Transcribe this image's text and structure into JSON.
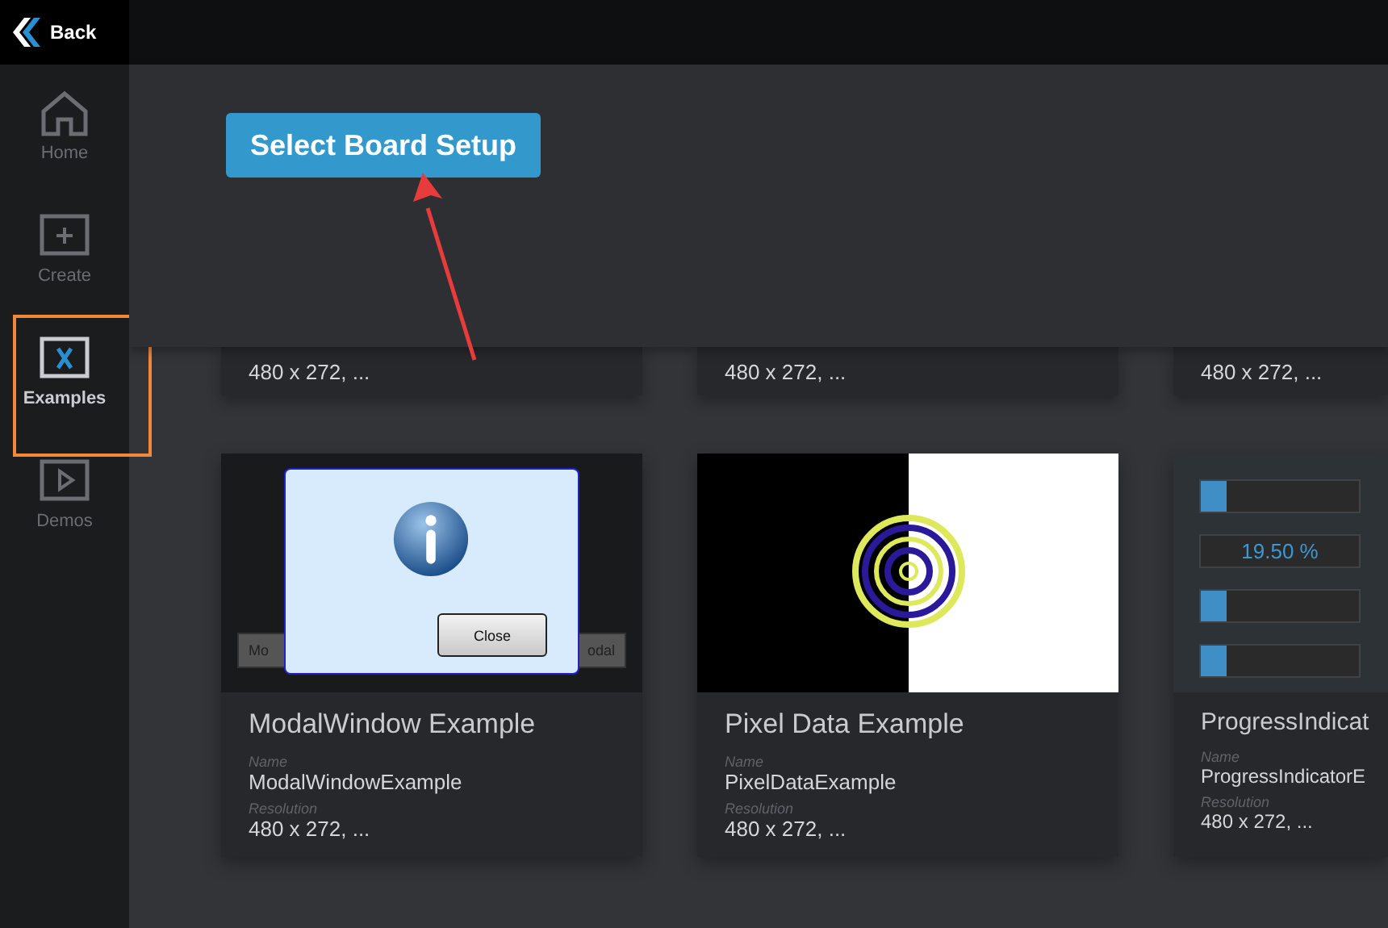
{
  "back": {
    "label": "Back"
  },
  "nav": [
    {
      "kind": "home",
      "label": "Home",
      "selected": false
    },
    {
      "kind": "create",
      "label": "Create",
      "selected": false
    },
    {
      "kind": "examples",
      "label": "Examples",
      "selected": true
    },
    {
      "kind": "demos",
      "label": "Demos",
      "selected": false
    }
  ],
  "header": {
    "button": "Select Board Setup"
  },
  "top_cards": [
    {
      "resolution": "480 x 272, ..."
    },
    {
      "resolution": "480 x 272, ..."
    },
    {
      "resolution": "480 x 272, ..."
    }
  ],
  "cards": [
    {
      "kind": "modal",
      "title": "ModalWindow Example",
      "name_label": "Name",
      "name": "ModalWindowExample",
      "resolution_label": "Resolution",
      "resolution": "480 x 272, ...",
      "preview": {
        "buttons": [
          "Mo",
          "odal"
        ],
        "dialog_button": "Close"
      }
    },
    {
      "kind": "pixel",
      "title": "Pixel Data Example",
      "name_label": "Name",
      "name": "PixelDataExample",
      "resolution_label": "Resolution",
      "resolution": "480 x 272, ..."
    },
    {
      "kind": "progress",
      "title": "ProgressIndicat",
      "name_label": "Name",
      "name": "ProgressIndicatorE",
      "resolution_label": "Resolution",
      "resolution": "480 x 272, ...",
      "preview": {
        "rows": [
          {
            "kind": "bar",
            "level": 0.16
          },
          {
            "kind": "readout",
            "text": "19.50 %"
          },
          {
            "kind": "bar",
            "level": 0.16
          },
          {
            "kind": "bar",
            "level": 0.16
          }
        ]
      }
    }
  ]
}
